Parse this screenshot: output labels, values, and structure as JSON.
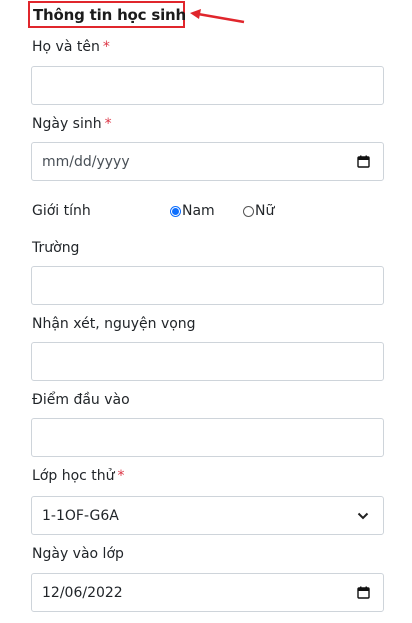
{
  "section_title": "Thông tin học sinh",
  "annotation_color": "#e0262c",
  "form": {
    "full_name": {
      "label": "Họ và tên",
      "required_mark": "*",
      "value": ""
    },
    "birth_date": {
      "label": "Ngày sinh",
      "required_mark": "*",
      "value": "mm/dd/yyyy",
      "icon": "calendar-icon"
    },
    "gender": {
      "label": "Giới tính",
      "options": [
        {
          "label": "Nam",
          "checked": true
        },
        {
          "label": "Nữ",
          "checked": false
        }
      ]
    },
    "school": {
      "label": "Trường",
      "value": ""
    },
    "comments": {
      "label": "Nhận xét, nguyện vọng",
      "value": ""
    },
    "entry_score": {
      "label": "Điểm đầu vào",
      "value": ""
    },
    "trial_class": {
      "label": "Lớp học thử",
      "required_mark": "*",
      "value": "1-1OF-G6A",
      "icon": "chevron-down-icon"
    },
    "join_date": {
      "label": "Ngày vào lớp",
      "value": "12/06/2022",
      "icon": "calendar-icon"
    }
  }
}
